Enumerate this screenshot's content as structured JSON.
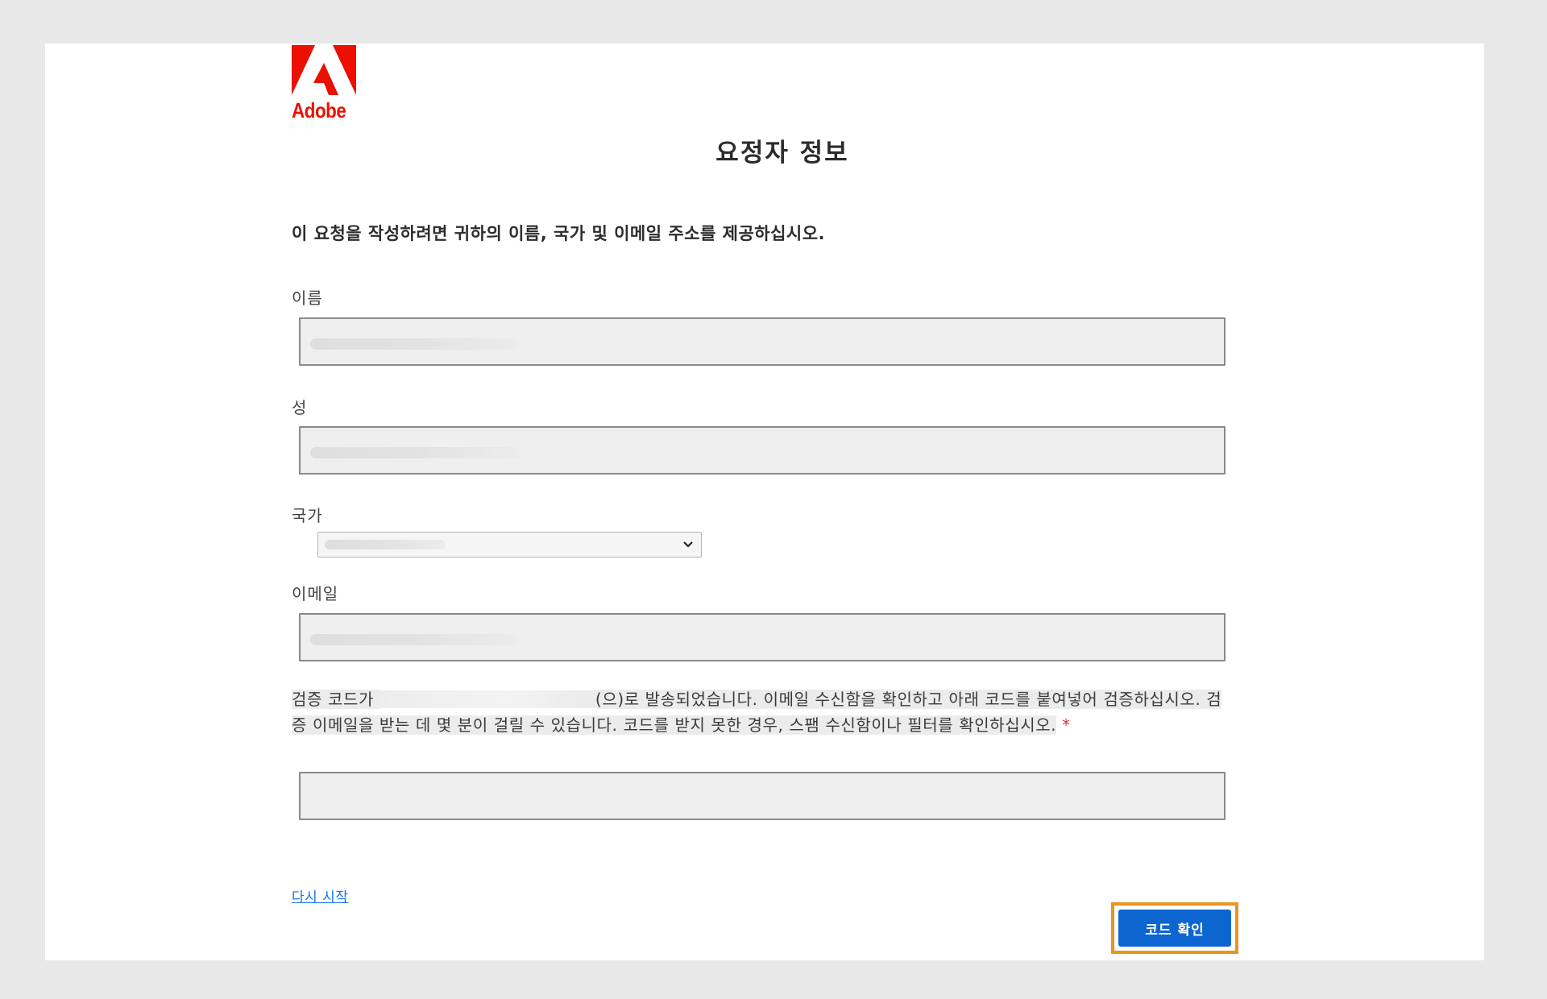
{
  "brand": {
    "logo_text": "Adobe",
    "color": "#eb1000"
  },
  "form": {
    "title": "요정자 정보",
    "intro": "이 요청을 작성하려면 귀하의 이름, 국가 및 이메일 주소를 제공하십시오.",
    "first_name_label": "이름",
    "last_name_label": "성",
    "country_label": "국가",
    "email_label": "이메일",
    "verify_prefix": "검증 코드가 ",
    "verify_after_email": "(으)로 발송되었습니다. 이메일 수신함을 확인하고 아래 코드를 붙여넣어 검증하십시오. 검증 이메일을 받는 데 몇 분이 걸릴 수 있습니다. 코드를 받지 못한 경우, 스팸 수신함이나 필터를 확인하십시오.",
    "required_mark": "*",
    "restart_link": "다시 시작",
    "submit_button": "코드 확인"
  },
  "colors": {
    "button": "#0d66d0",
    "highlight_border": "#e8951f",
    "link": "#1473e6",
    "required": "#d7373f"
  }
}
